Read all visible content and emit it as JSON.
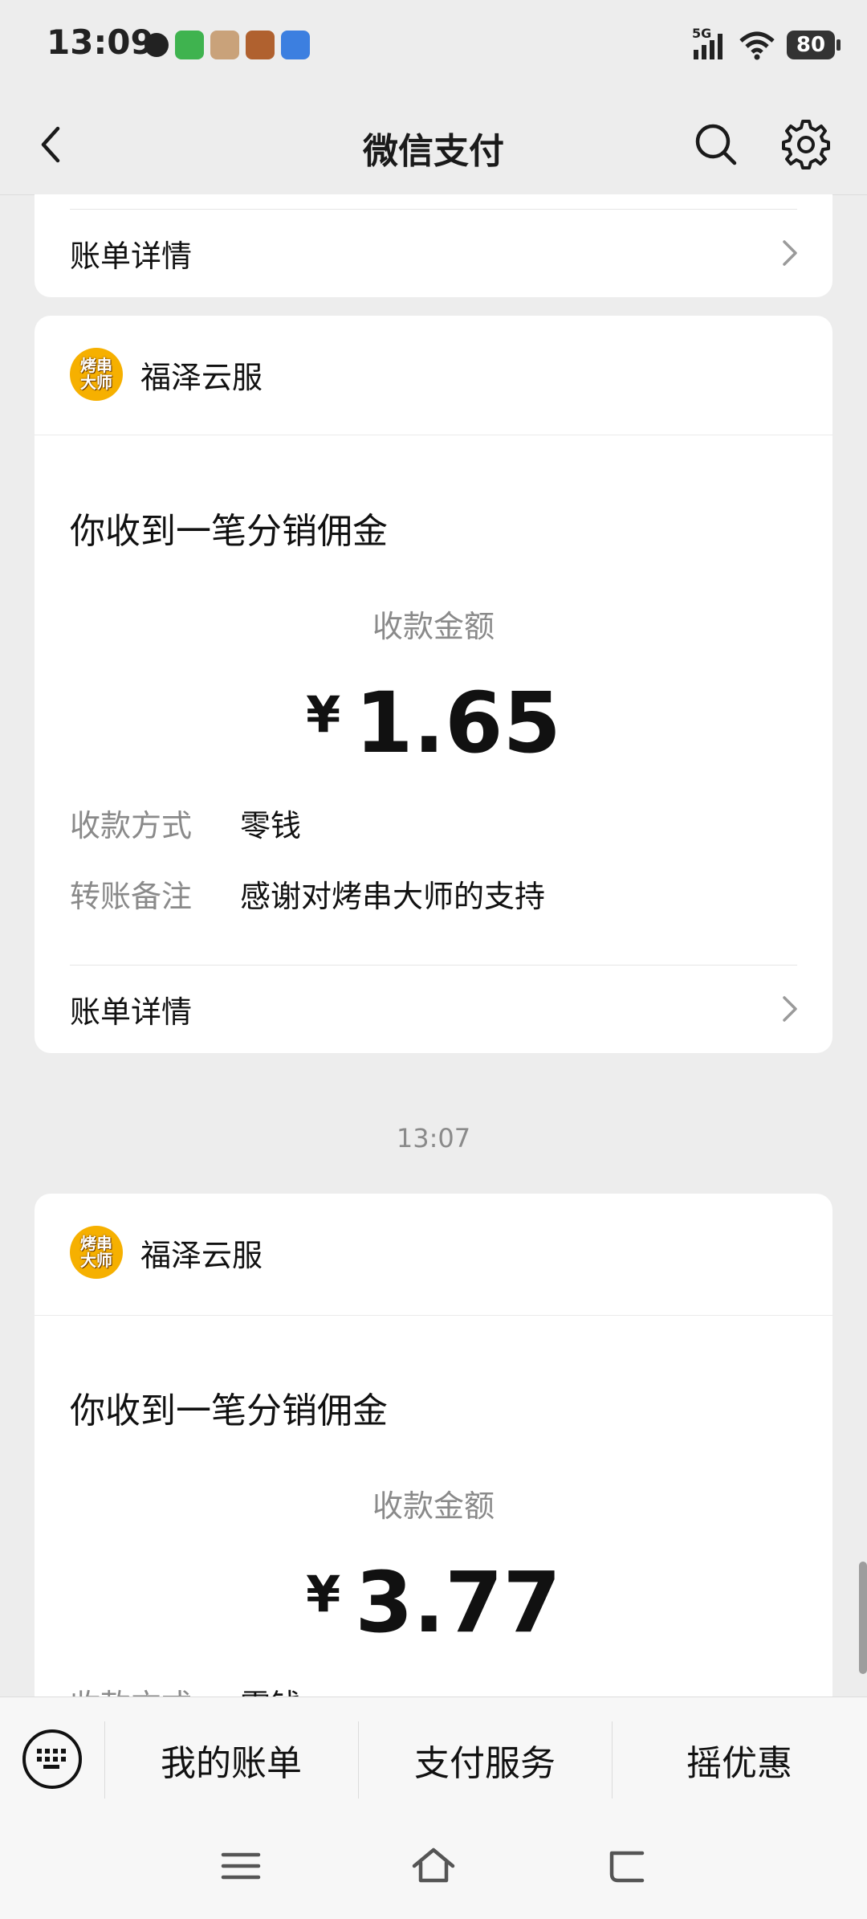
{
  "status_bar": {
    "time": "13:09",
    "network": "5G",
    "battery": "80"
  },
  "header": {
    "title": "微信支付"
  },
  "top_card": {
    "detail_label": "账单详情"
  },
  "cards": [
    {
      "merchant_logo_text": "烤串大师",
      "merchant_name": "福泽云服",
      "message_title": "你收到一笔分销佣金",
      "amount_label": "收款金额",
      "currency": "¥",
      "amount": "1.65",
      "method_label": "收款方式",
      "method_value": "零钱",
      "note_label": "转账备注",
      "note_value": "感谢对烤串大师的支持",
      "detail_label": "账单详情"
    },
    {
      "merchant_logo_text": "烤串大师",
      "merchant_name": "福泽云服",
      "message_title": "你收到一笔分销佣金",
      "amount_label": "收款金额",
      "currency": "¥",
      "amount": "3.77",
      "method_label": "收款方式",
      "method_value": "零钱"
    }
  ],
  "timestamp": "13:07",
  "bottom_menu": {
    "items": [
      {
        "label": "我的账单"
      },
      {
        "label": "支付服务"
      },
      {
        "label": "摇优惠"
      }
    ]
  },
  "icons": [
    "back-icon",
    "search-icon",
    "gear-icon",
    "chevron-right-icon",
    "keyboard-icon",
    "menu-icon",
    "home-icon",
    "return-icon"
  ],
  "colors": {
    "background": "#ededed",
    "card": "#ffffff",
    "logo": "#f6b000",
    "muted_text": "#8a8a8a"
  }
}
